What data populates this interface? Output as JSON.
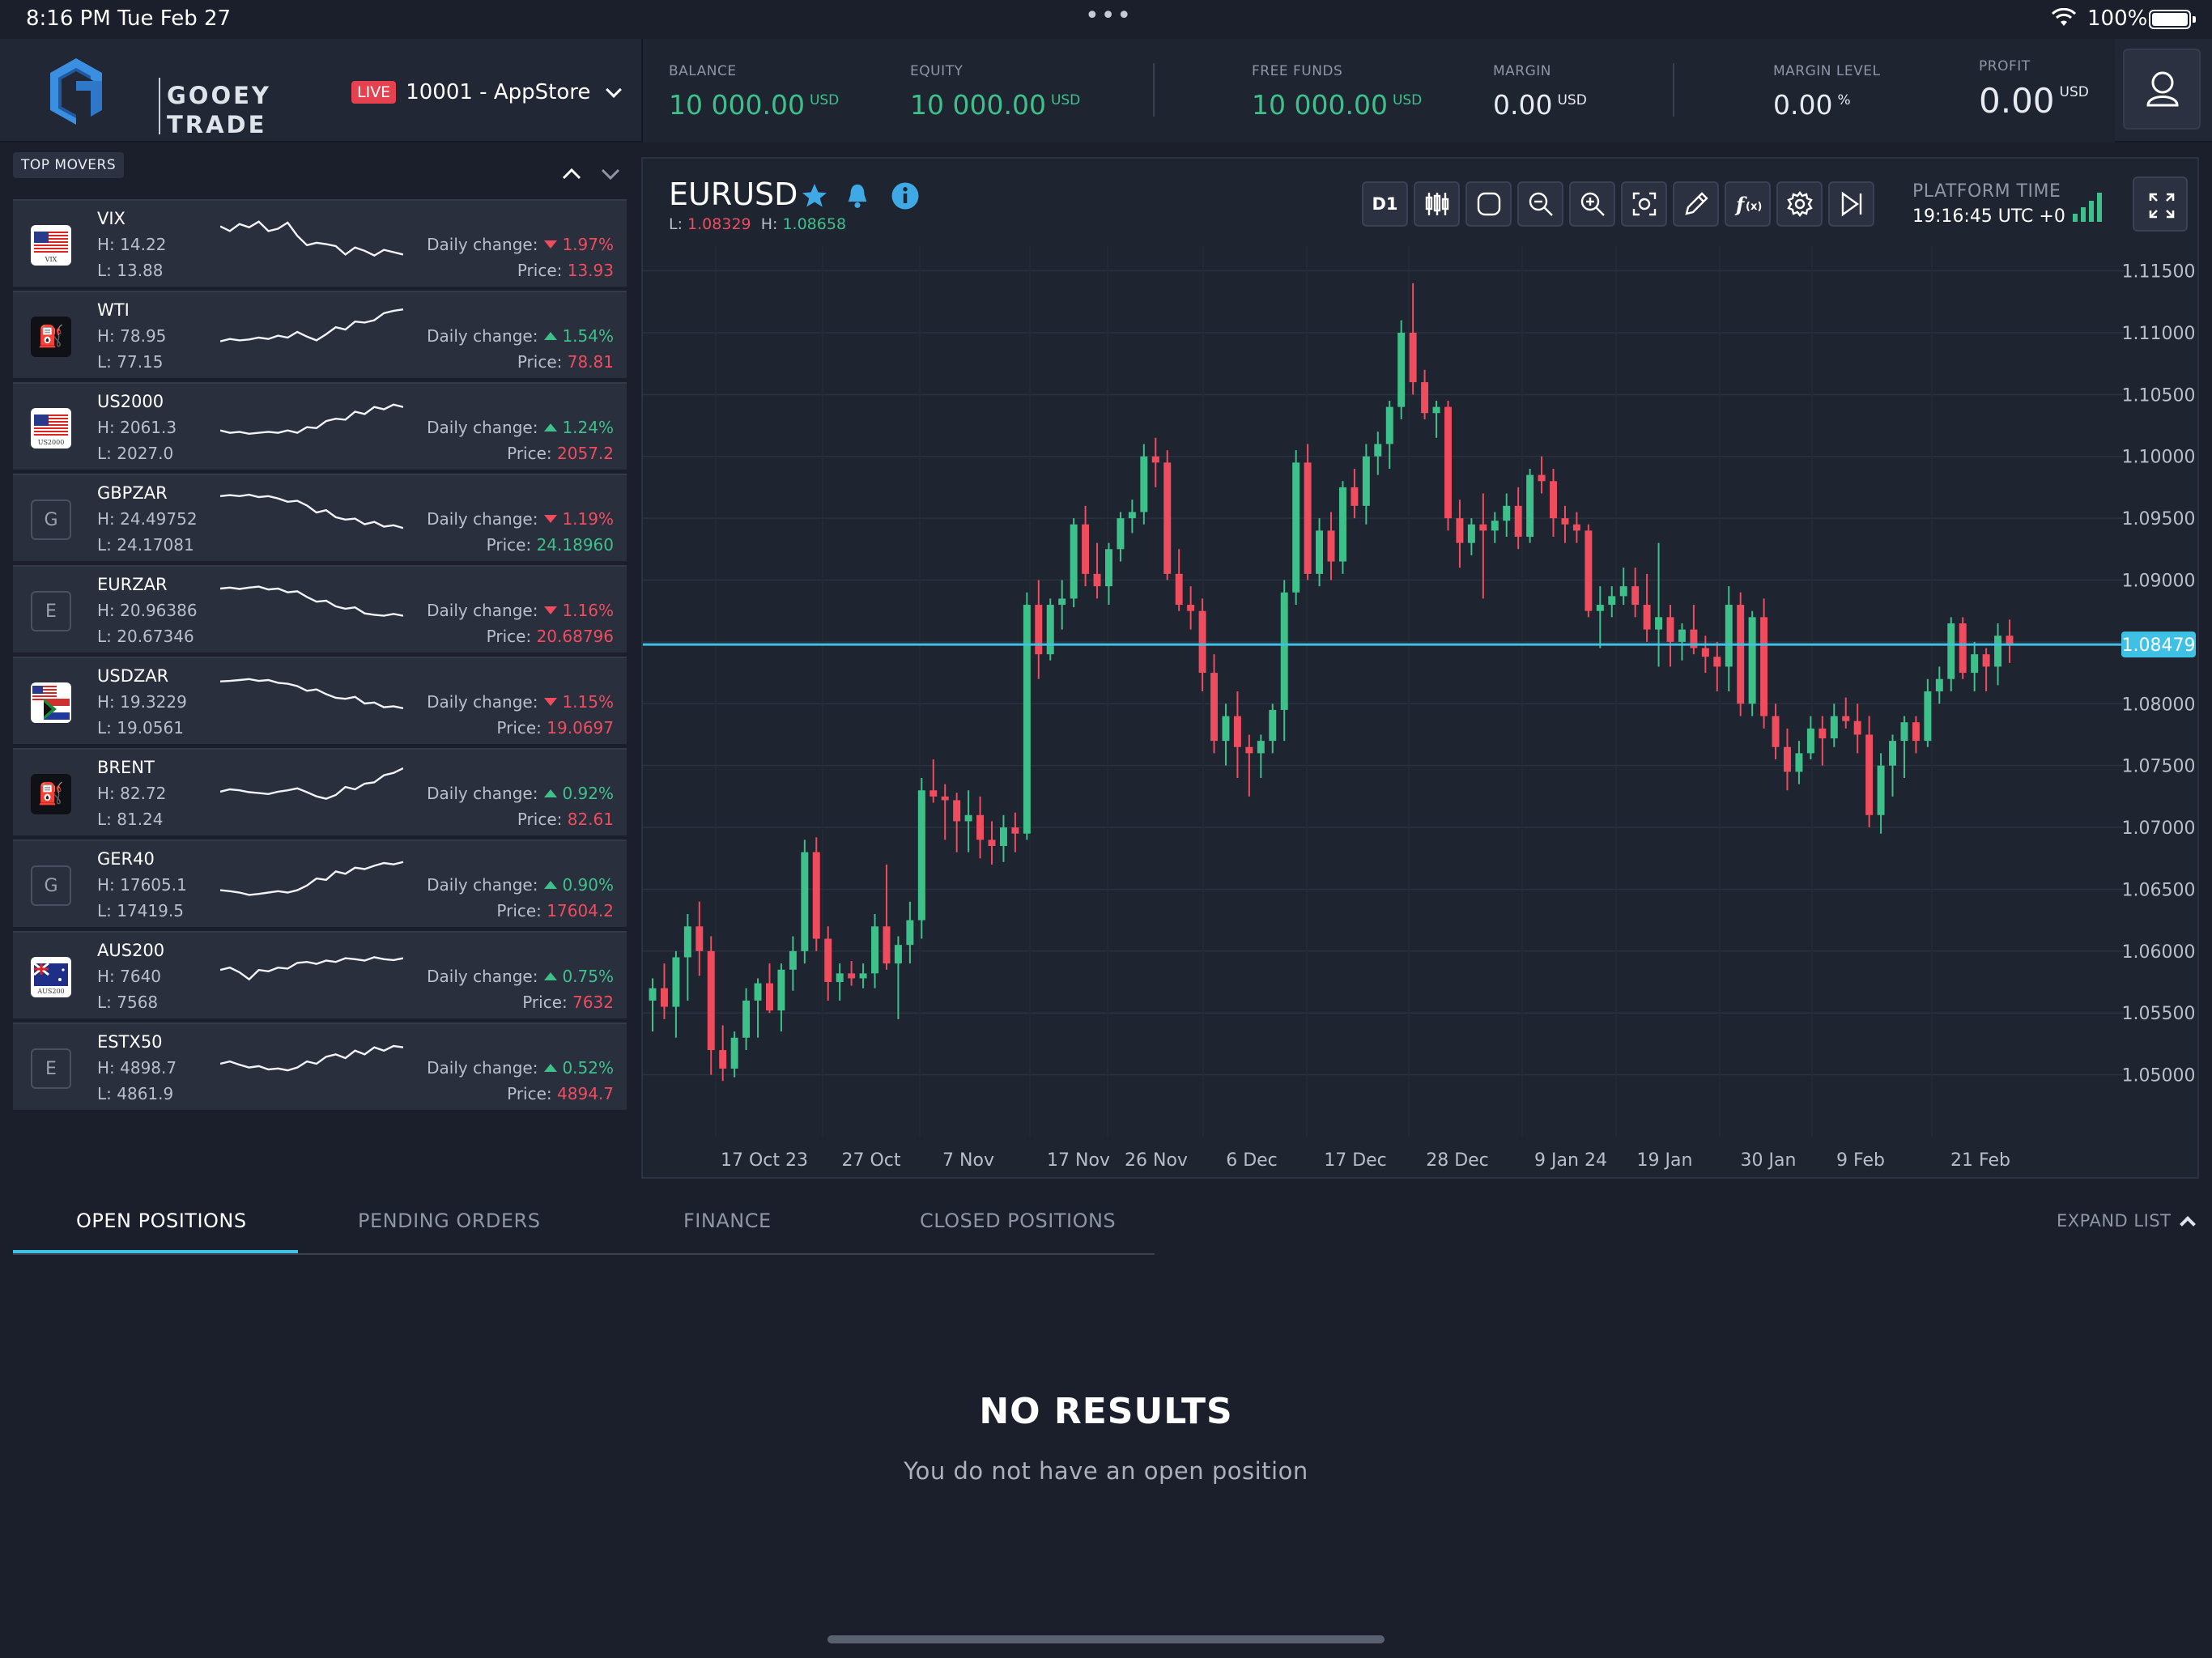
{
  "status_bar": {
    "time": "8:16 PM   Tue Feb 27",
    "dots": "•••",
    "battery": "100%"
  },
  "header": {
    "logo_line1": "GOOEY",
    "logo_line2": "TRADE",
    "live_label": "LIVE",
    "account": "10001 - AppStore",
    "metrics": [
      {
        "label": "BALANCE",
        "value": "10 000.00",
        "unit": "USD",
        "color": "#3ec08a"
      },
      {
        "label": "EQUITY",
        "value": "10 000.00",
        "unit": "USD",
        "color": "#3ec08a"
      },
      {
        "label": "FREE FUNDS",
        "value": "10 000.00",
        "unit": "USD",
        "color": "#3ec08a"
      },
      {
        "label": "MARGIN",
        "value": "0.00",
        "unit": "USD",
        "color": "#e8ebf0"
      },
      {
        "label": "MARGIN LEVEL",
        "value": "0.00",
        "unit": "%",
        "color": "#e8ebf0"
      },
      {
        "label": "PROFIT",
        "value": "0.00",
        "unit": "USD",
        "color": "#e8ebf0"
      }
    ]
  },
  "movers": {
    "title": "TOP MOVERS",
    "items": [
      {
        "symbol": "VIX",
        "icon": "us-flag",
        "icon_text": "VIX",
        "high": "H: 14.22",
        "low": "L: 13.88",
        "change_label": "Daily change:",
        "direction": "down",
        "change": "1.97%",
        "price_label": "Price:",
        "price": "13.93",
        "price_color": "#ef4c5e",
        "spark": [
          0.8,
          0.7,
          0.85,
          0.78,
          0.9,
          0.7,
          0.75,
          0.88,
          0.6,
          0.4,
          0.45,
          0.42,
          0.38,
          0.2,
          0.35,
          0.28,
          0.18,
          0.3,
          0.25,
          0.2
        ]
      },
      {
        "symbol": "WTI",
        "icon": "oil",
        "icon_text": "⛽",
        "high": "H: 78.95",
        "low": "L: 77.15",
        "change_label": "Daily change:",
        "direction": "up",
        "change": "1.54%",
        "price_label": "Price:",
        "price": "78.81",
        "price_color": "#ef4c5e",
        "spark": [
          0.3,
          0.35,
          0.32,
          0.34,
          0.38,
          0.35,
          0.42,
          0.38,
          0.5,
          0.4,
          0.32,
          0.45,
          0.6,
          0.55,
          0.72,
          0.7,
          0.75,
          0.9,
          0.95,
          0.98
        ]
      },
      {
        "symbol": "US2000",
        "icon": "us-flag",
        "icon_text": "US2000",
        "high": "H: 2061.3",
        "low": "L: 2027.0",
        "change_label": "Daily change:",
        "direction": "up",
        "change": "1.24%",
        "price_label": "Price:",
        "price": "2057.2",
        "price_color": "#ef4c5e",
        "spark": [
          0.35,
          0.3,
          0.32,
          0.28,
          0.3,
          0.32,
          0.3,
          0.35,
          0.3,
          0.42,
          0.4,
          0.55,
          0.6,
          0.58,
          0.75,
          0.7,
          0.85,
          0.8,
          0.9,
          0.85
        ]
      },
      {
        "symbol": "GBPZAR",
        "icon": "letter",
        "icon_text": "G",
        "high": "H: 24.49752",
        "low": "L: 24.17081",
        "change_label": "Daily change:",
        "direction": "down",
        "change": "1.19%",
        "price_label": "Price:",
        "price": "24.18960",
        "price_color": "#3ec08a",
        "spark": [
          0.9,
          0.92,
          0.9,
          0.93,
          0.88,
          0.9,
          0.85,
          0.78,
          0.8,
          0.7,
          0.55,
          0.6,
          0.45,
          0.4,
          0.42,
          0.3,
          0.35,
          0.25,
          0.28,
          0.22
        ]
      },
      {
        "symbol": "EURZAR",
        "icon": "letter",
        "icon_text": "E",
        "high": "H: 20.96386",
        "low": "L: 20.67346",
        "change_label": "Daily change:",
        "direction": "down",
        "change": "1.16%",
        "price_label": "Price:",
        "price": "20.68796",
        "price_color": "#ef4c5e",
        "spark": [
          0.88,
          0.9,
          0.87,
          0.9,
          0.92,
          0.86,
          0.88,
          0.8,
          0.82,
          0.7,
          0.6,
          0.62,
          0.5,
          0.45,
          0.48,
          0.35,
          0.32,
          0.3,
          0.34,
          0.3
        ]
      },
      {
        "symbol": "USDZAR",
        "icon": "us-za-flag",
        "icon_text": "",
        "high": "H: 19.3229",
        "low": "L: 19.0561",
        "change_label": "Daily change:",
        "direction": "down",
        "change": "1.15%",
        "price_label": "Price:",
        "price": "19.0697",
        "price_color": "#ef4c5e",
        "spark": [
          0.85,
          0.86,
          0.88,
          0.9,
          0.86,
          0.88,
          0.82,
          0.8,
          0.75,
          0.65,
          0.68,
          0.58,
          0.5,
          0.48,
          0.52,
          0.38,
          0.4,
          0.3,
          0.32,
          0.28
        ]
      },
      {
        "symbol": "BRENT",
        "icon": "oil",
        "icon_text": "⛽",
        "high": "H: 82.72",
        "low": "L: 81.24",
        "change_label": "Daily change:",
        "direction": "up",
        "change": "0.92%",
        "price_label": "Price:",
        "price": "82.61",
        "price_color": "#ef4c5e",
        "spark": [
          0.45,
          0.5,
          0.48,
          0.44,
          0.42,
          0.4,
          0.45,
          0.48,
          0.52,
          0.44,
          0.35,
          0.3,
          0.38,
          0.55,
          0.5,
          0.62,
          0.65,
          0.8,
          0.85,
          0.95
        ]
      },
      {
        "symbol": "GER40",
        "icon": "letter",
        "icon_text": "G",
        "high": "H: 17605.1",
        "low": "L: 17419.5",
        "change_label": "Daily change:",
        "direction": "up",
        "change": "0.90%",
        "price_label": "Price:",
        "price": "17604.2",
        "price_color": "#ef4c5e",
        "spark": [
          0.3,
          0.28,
          0.25,
          0.2,
          0.22,
          0.25,
          0.28,
          0.25,
          0.3,
          0.4,
          0.55,
          0.52,
          0.7,
          0.65,
          0.78,
          0.75,
          0.82,
          0.88,
          0.85,
          0.9
        ]
      },
      {
        "symbol": "AUS200",
        "icon": "au-flag",
        "icon_text": "AUS200",
        "high": "H: 7640",
        "low": "L: 7568",
        "change_label": "Daily change:",
        "direction": "up",
        "change": "0.75%",
        "price_label": "Price:",
        "price": "7632",
        "price_color": "#ef4c5e",
        "spark": [
          0.55,
          0.6,
          0.5,
          0.35,
          0.55,
          0.52,
          0.6,
          0.58,
          0.7,
          0.72,
          0.68,
          0.75,
          0.72,
          0.8,
          0.78,
          0.75,
          0.82,
          0.78,
          0.76,
          0.8
        ]
      },
      {
        "symbol": "ESTX50",
        "icon": "letter",
        "icon_text": "E",
        "high": "H: 4898.7",
        "low": "L: 4861.9",
        "change_label": "Daily change:",
        "direction": "up",
        "change": "0.52%",
        "price_label": "Price:",
        "price": "4894.7",
        "price_color": "#ef4c5e",
        "spark": [
          0.5,
          0.55,
          0.48,
          0.42,
          0.45,
          0.38,
          0.4,
          0.36,
          0.42,
          0.55,
          0.5,
          0.65,
          0.7,
          0.62,
          0.78,
          0.7,
          0.85,
          0.78,
          0.88,
          0.85
        ]
      }
    ]
  },
  "chart_panel": {
    "symbol": "EURUSD",
    "low_label": "L:",
    "low_value": "1.08329",
    "high_label": "H:",
    "high_value": "1.08658",
    "timeframe": "D1",
    "platform_time_label": "PLATFORM TIME",
    "platform_time": "19:16:45 UTC +0"
  },
  "chart_data": {
    "type": "candlestick",
    "current_price": "1.08479",
    "ylim": [
      1.045,
      1.117
    ],
    "y_ticks": [
      "1.11500",
      "1.11000",
      "1.10500",
      "1.10000",
      "1.09500",
      "1.09000",
      "1.08500",
      "1.08000",
      "1.07500",
      "1.07000",
      "1.06500",
      "1.06000",
      "1.05500",
      "1.05000"
    ],
    "x_labels": [
      "17 Oct 23",
      "27 Oct",
      "7 Nov",
      "17 Nov",
      "26 Nov",
      "6 Dec",
      "17 Dec",
      "28 Dec",
      "9 Jan 24",
      "19 Jan",
      "30 Jan",
      "9 Feb",
      "21 Feb"
    ],
    "candles": [
      [
        1.056,
        1.0578,
        1.0535,
        1.057
      ],
      [
        1.057,
        1.059,
        1.0545,
        1.0555
      ],
      [
        1.0555,
        1.06,
        1.053,
        1.0595
      ],
      [
        1.0595,
        1.063,
        1.056,
        1.062
      ],
      [
        1.062,
        1.064,
        1.058,
        1.06
      ],
      [
        1.06,
        1.0612,
        1.05,
        1.052
      ],
      [
        1.052,
        1.054,
        1.0495,
        1.0505
      ],
      [
        1.0505,
        1.0535,
        1.0498,
        1.053
      ],
      [
        1.053,
        1.057,
        1.052,
        1.056
      ],
      [
        1.056,
        1.0578,
        1.053,
        1.0574
      ],
      [
        1.0574,
        1.059,
        1.055,
        1.0552
      ],
      [
        1.0552,
        1.059,
        1.0535,
        1.0585
      ],
      [
        1.0585,
        1.0612,
        1.0568,
        1.06
      ],
      [
        1.06,
        1.069,
        1.059,
        1.068
      ],
      [
        1.068,
        1.0692,
        1.06,
        1.061
      ],
      [
        1.061,
        1.062,
        1.056,
        1.0575
      ],
      [
        1.0575,
        1.059,
        1.056,
        1.0582
      ],
      [
        1.0582,
        1.0592,
        1.0572,
        1.0578
      ],
      [
        1.0578,
        1.059,
        1.057,
        1.0582
      ],
      [
        1.0582,
        1.063,
        1.057,
        1.062
      ],
      [
        1.062,
        1.067,
        1.0585,
        1.059
      ],
      [
        1.059,
        1.0612,
        1.0545,
        1.0605
      ],
      [
        1.0605,
        1.064,
        1.059,
        1.0625
      ],
      [
        1.0625,
        1.074,
        1.061,
        1.073
      ],
      [
        1.073,
        1.0755,
        1.072,
        1.0725
      ],
      [
        1.0725,
        1.0735,
        1.069,
        1.0722
      ],
      [
        1.0722,
        1.0728,
        1.068,
        1.0705
      ],
      [
        1.0705,
        1.073,
        1.068,
        1.071
      ],
      [
        1.071,
        1.0725,
        1.0675,
        1.069
      ],
      [
        1.069,
        1.0705,
        1.067,
        1.0685
      ],
      [
        1.0685,
        1.071,
        1.0672,
        1.07
      ],
      [
        1.07,
        1.0712,
        1.068,
        1.0695
      ],
      [
        1.0695,
        1.089,
        1.069,
        1.088
      ],
      [
        1.088,
        1.09,
        1.082,
        1.084
      ],
      [
        1.084,
        1.0885,
        1.0835,
        1.088
      ],
      [
        1.088,
        1.09,
        1.086,
        1.0885
      ],
      [
        1.0885,
        1.095,
        1.0878,
        1.0945
      ],
      [
        1.0945,
        1.096,
        1.0895,
        1.0905
      ],
      [
        1.0905,
        1.093,
        1.0885,
        1.0895
      ],
      [
        1.0895,
        1.093,
        1.088,
        1.0925
      ],
      [
        1.0925,
        1.0955,
        1.0915,
        1.095
      ],
      [
        1.095,
        1.0965,
        1.0938,
        1.0955
      ],
      [
        1.0955,
        1.101,
        1.0945,
        1.1
      ],
      [
        1.1,
        1.1015,
        1.0975,
        1.0995
      ],
      [
        1.0995,
        1.1005,
        1.09,
        1.0905
      ],
      [
        1.0905,
        1.0925,
        1.0875,
        1.088
      ],
      [
        1.088,
        1.0895,
        1.086,
        1.0875
      ],
      [
        1.0875,
        1.0885,
        1.081,
        1.0825
      ],
      [
        1.0825,
        1.084,
        1.076,
        1.077
      ],
      [
        1.077,
        1.08,
        1.075,
        1.079
      ],
      [
        1.079,
        1.081,
        1.074,
        1.0765
      ],
      [
        1.0765,
        1.0775,
        1.0725,
        1.076
      ],
      [
        1.076,
        1.0775,
        1.074,
        1.077
      ],
      [
        1.077,
        1.08,
        1.076,
        1.0795
      ],
      [
        1.0795,
        1.09,
        1.077,
        1.089
      ],
      [
        1.089,
        1.1005,
        1.088,
        1.0995
      ],
      [
        1.0995,
        1.101,
        1.09,
        1.0905
      ],
      [
        1.0905,
        1.095,
        1.0895,
        1.094
      ],
      [
        1.094,
        1.0955,
        1.09,
        1.0915
      ],
      [
        1.0915,
        1.098,
        1.0905,
        1.0975
      ],
      [
        1.0975,
        1.099,
        1.095,
        1.096
      ],
      [
        1.096,
        1.101,
        1.0945,
        1.1
      ],
      [
        1.1,
        1.102,
        1.0985,
        1.101
      ],
      [
        1.101,
        1.1045,
        1.099,
        1.104
      ],
      [
        1.104,
        1.111,
        1.103,
        1.11
      ],
      [
        1.11,
        1.114,
        1.105,
        1.106
      ],
      [
        1.106,
        1.107,
        1.103,
        1.1035
      ],
      [
        1.1035,
        1.1045,
        1.1015,
        1.104
      ],
      [
        1.104,
        1.1045,
        1.094,
        1.095
      ],
      [
        1.095,
        1.0965,
        1.091,
        1.093
      ],
      [
        1.093,
        1.095,
        1.092,
        1.0945
      ],
      [
        1.0945,
        1.097,
        1.0885,
        1.094
      ],
      [
        1.094,
        1.0955,
        1.093,
        1.0948
      ],
      [
        1.0948,
        1.097,
        1.0935,
        1.096
      ],
      [
        1.096,
        1.0975,
        1.0925,
        1.0935
      ],
      [
        1.0935,
        1.099,
        1.093,
        1.0985
      ],
      [
        1.0985,
        1.1,
        1.097,
        1.098
      ],
      [
        1.098,
        1.099,
        1.0935,
        1.095
      ],
      [
        1.095,
        1.096,
        1.093,
        1.0945
      ],
      [
        1.0945,
        1.0955,
        1.093,
        1.094
      ],
      [
        1.094,
        1.0945,
        1.087,
        1.0875
      ],
      [
        1.0875,
        1.0895,
        1.0845,
        1.088
      ],
      [
        1.088,
        1.0895,
        1.087,
        1.0887
      ],
      [
        1.0887,
        1.091,
        1.088,
        1.0895
      ],
      [
        1.0895,
        1.091,
        1.087,
        1.088
      ],
      [
        1.088,
        1.0905,
        1.085,
        1.086
      ],
      [
        1.086,
        1.093,
        1.083,
        1.087
      ],
      [
        1.087,
        1.088,
        1.083,
        1.085
      ],
      [
        1.085,
        1.0865,
        1.0835,
        1.086
      ],
      [
        1.086,
        1.088,
        1.084,
        1.0845
      ],
      [
        1.0845,
        1.0855,
        1.0825,
        1.0838
      ],
      [
        1.0838,
        1.085,
        1.081,
        1.083
      ],
      [
        1.083,
        1.0895,
        1.081,
        1.088
      ],
      [
        1.088,
        1.089,
        1.079,
        1.08
      ],
      [
        1.08,
        1.0875,
        1.079,
        1.087
      ],
      [
        1.087,
        1.0885,
        1.078,
        1.079
      ],
      [
        1.079,
        1.08,
        1.0755,
        1.0765
      ],
      [
        1.0765,
        1.078,
        1.073,
        1.0745
      ],
      [
        1.0745,
        1.077,
        1.0735,
        1.076
      ],
      [
        1.076,
        1.079,
        1.0755,
        1.078
      ],
      [
        1.078,
        1.079,
        1.075,
        1.0772
      ],
      [
        1.0772,
        1.08,
        1.0765,
        1.079
      ],
      [
        1.079,
        1.0805,
        1.078,
        1.0786
      ],
      [
        1.0786,
        1.08,
        1.076,
        1.0775
      ],
      [
        1.0775,
        1.079,
        1.07,
        1.071
      ],
      [
        1.071,
        1.076,
        1.0695,
        1.075
      ],
      [
        1.075,
        1.0775,
        1.0725,
        1.077
      ],
      [
        1.077,
        1.079,
        1.074,
        1.0785
      ],
      [
        1.0785,
        1.079,
        1.076,
        1.077
      ],
      [
        1.077,
        1.082,
        1.0765,
        1.081
      ],
      [
        1.081,
        1.083,
        1.08,
        1.082
      ],
      [
        1.082,
        1.087,
        1.081,
        1.0865
      ],
      [
        1.0865,
        1.087,
        1.082,
        1.0825
      ],
      [
        1.0825,
        1.085,
        1.081,
        1.084
      ],
      [
        1.084,
        1.0845,
        1.081,
        1.083
      ],
      [
        1.083,
        1.0865,
        1.0815,
        1.0855
      ],
      [
        1.0855,
        1.0868,
        1.0833,
        1.0848
      ]
    ]
  },
  "tabs": [
    "OPEN POSITIONS",
    "PENDING ORDERS",
    "FINANCE",
    "CLOSED POSITIONS"
  ],
  "expand_label": "EXPAND LIST",
  "empty_state": {
    "title": "NO RESULTS",
    "subtitle": "You do not have an open position"
  }
}
